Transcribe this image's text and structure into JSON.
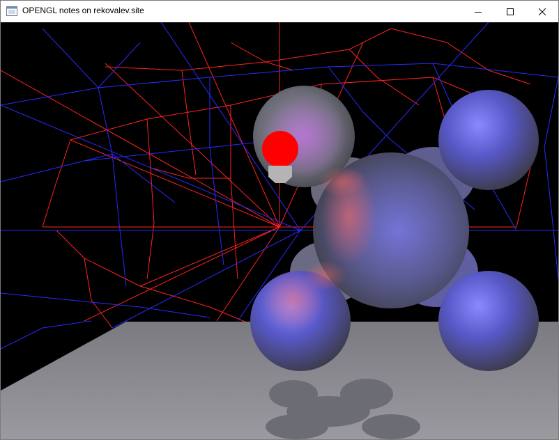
{
  "window": {
    "title": "OPENGL notes on rekovalev.site",
    "controls": [
      {
        "name": "minimize",
        "icon": "minimize-icon"
      },
      {
        "name": "maximize",
        "icon": "maximize-icon"
      },
      {
        "name": "close",
        "icon": "close-icon"
      }
    ]
  },
  "scene": {
    "background": "#000000",
    "wire_colors": {
      "red": "#ff2020",
      "blue": "#2020ff"
    },
    "floor_color": "#8a8a90",
    "light_color": "#ff0000",
    "molecule_colors": {
      "gray": "#7a7a80",
      "blue": "#5a5acc",
      "red": "#e06060"
    }
  }
}
